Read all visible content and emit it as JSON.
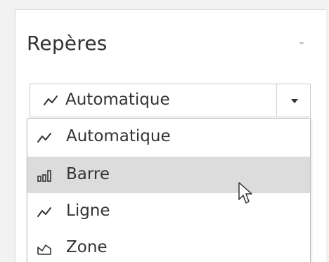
{
  "panel": {
    "title": "Repères"
  },
  "mark_type": {
    "selected": "Automatique",
    "selected_icon": "line-auto-icon"
  },
  "dropdown": {
    "options": [
      {
        "label": "Automatique",
        "icon": "line-auto-icon"
      },
      {
        "label": "Barre",
        "icon": "bar-chart-icon"
      },
      {
        "label": "Ligne",
        "icon": "line-chart-icon"
      },
      {
        "label": "Zone",
        "icon": "area-chart-icon"
      }
    ],
    "highlighted_index": 1
  },
  "colors": {
    "panel_background": "#ffffff",
    "canvas_background": "#f2f2f2",
    "highlight": "#dcdcdc",
    "text": "#333333"
  }
}
